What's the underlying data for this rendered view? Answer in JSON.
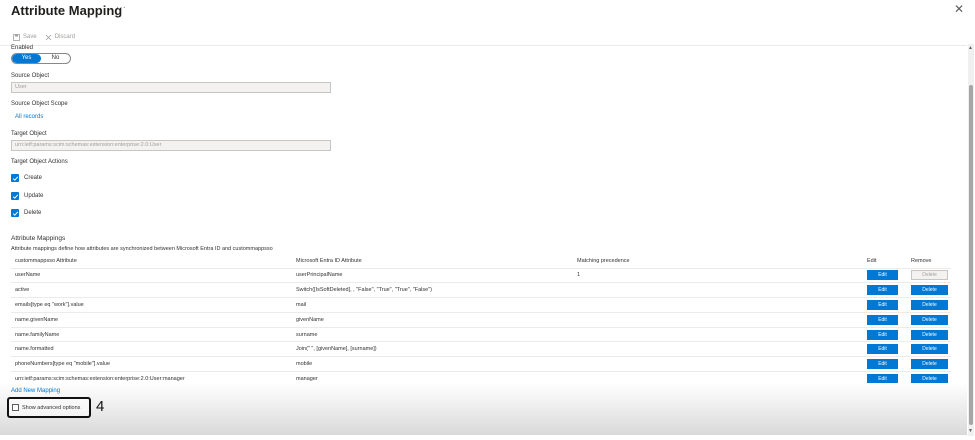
{
  "header": {
    "title": "Attribute Mapping",
    "more": "···",
    "close": "✕"
  },
  "toolbar": {
    "save_label": "Save",
    "discard_label": "Discard"
  },
  "enabled": {
    "label": "Enabled",
    "yes": "Yes",
    "no": "No"
  },
  "source_object": {
    "label": "Source Object",
    "value": "User"
  },
  "source_scope": {
    "label": "Source Object Scope",
    "value": "All records"
  },
  "target_object": {
    "label": "Target Object",
    "value": "urn:ietf:params:scim:schemas:extension:enterprise:2.0:User"
  },
  "target_actions": {
    "label": "Target Object Actions",
    "items": [
      {
        "label": "Create"
      },
      {
        "label": "Update"
      },
      {
        "label": "Delete"
      }
    ]
  },
  "mappings": {
    "title": "Attribute Mappings",
    "description": "Attribute mappings define how attributes are synchronized between Microsoft Entra ID and custommappsso",
    "headers": [
      "custommappsso Attribute",
      "Microsoft Entra ID Attribute",
      "Matching precedence",
      "Edit",
      "Remove"
    ],
    "edit_label": "Edit",
    "delete_label": "Delete",
    "rows": [
      {
        "target": "userName",
        "source": "userPrincipalName",
        "precedence": "1"
      },
      {
        "target": "active",
        "source": "Switch([IsSoftDeleted], , \"False\", \"True\", \"True\", \"False\")",
        "precedence": ""
      },
      {
        "target": "emails[type eq \"work\"].value",
        "source": "mail",
        "precedence": ""
      },
      {
        "target": "name.givenName",
        "source": "givenName",
        "precedence": ""
      },
      {
        "target": "name.familyName",
        "source": "surname",
        "precedence": ""
      },
      {
        "target": "name.formatted",
        "source": "Join(\" \", [givenName], [surname])",
        "precedence": ""
      },
      {
        "target": "phoneNumbers[type eq \"mobile\"].value",
        "source": "mobile",
        "precedence": ""
      },
      {
        "target": "urn:ietf:params:scim:schemas:extension:enterprise:2.0:User:manager",
        "source": "manager",
        "precedence": ""
      }
    ]
  },
  "add_mapping": "Add New Mapping",
  "advanced": {
    "label": "Show advanced options",
    "step": "4"
  },
  "colors": {
    "accent": "#0078d4"
  }
}
